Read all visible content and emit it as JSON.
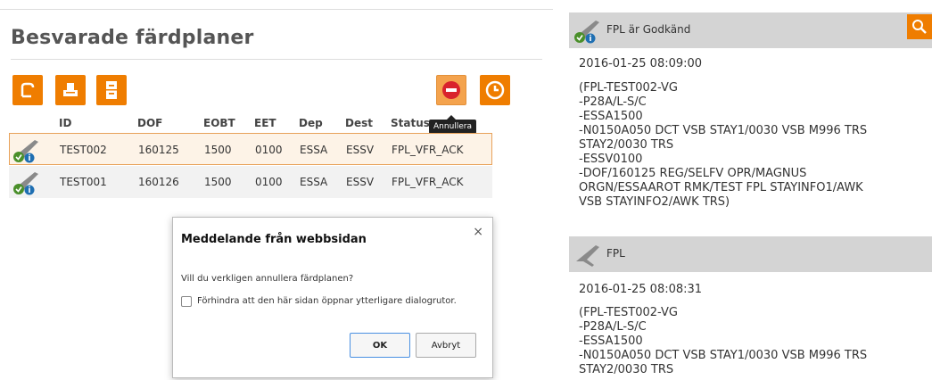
{
  "page": {
    "title": "Besvarade färdplaner"
  },
  "toolbar": {
    "open_icon": "open-icon",
    "print_icon": "print-icon",
    "archive_icon": "archive-icon",
    "cancel_icon": "cancel-icon",
    "time_icon": "clock-icon",
    "cancel_tooltip": "Annullera",
    "accent_color": "#ef7d00"
  },
  "table": {
    "columns": [
      "ID",
      "DOF",
      "EOBT",
      "EET",
      "Dep",
      "Dest",
      "Status"
    ],
    "rows": [
      {
        "id": "TEST002",
        "dof": "160125",
        "eobt": "1500",
        "eet": "0100",
        "dep": "ESSA",
        "dest": "ESSV",
        "status": "FPL_VFR_ACK",
        "selected": true
      },
      {
        "id": "TEST001",
        "dof": "160126",
        "eobt": "1500",
        "eet": "0100",
        "dep": "ESSA",
        "dest": "ESSV",
        "status": "FPL_VFR_ACK",
        "selected": false
      }
    ]
  },
  "dialog": {
    "title": "Meddelande från webbsidan",
    "close": "×",
    "message": "Vill du verkligen annullera färdplanen?",
    "checkbox_label": "Förhindra att den här sidan öppnar ytterligare dialogrutor.",
    "ok_label": "OK",
    "cancel_label": "Avbryt"
  },
  "right_panel": {
    "sections": [
      {
        "title": "FPL är Godkänd",
        "timestamp": "2016-01-25 08:09:00",
        "message": "(FPL-TEST002-VG\n-P28A/L-S/C\n-ESSA1500\n-N0150A050 DCT VSB STAY1/0030 VSB M996 TRS\nSTAY2/0030 TRS\n-ESSV0100\n-DOF/160125 REG/SELFV OPR/MAGNUS\nORGN/ESSAAROT RMK/TEST FPL STAYINFO1/AWK\nVSB STAYINFO2/AWK TRS)"
      },
      {
        "title": "FPL",
        "timestamp": "2016-01-25 08:08:31",
        "message": "(FPL-TEST002-VG\n-P28A/L-S/C\n-ESSA1500\n-N0150A050 DCT VSB STAY1/0030 VSB M996 TRS\nSTAY2/0030 TRS"
      }
    ]
  }
}
